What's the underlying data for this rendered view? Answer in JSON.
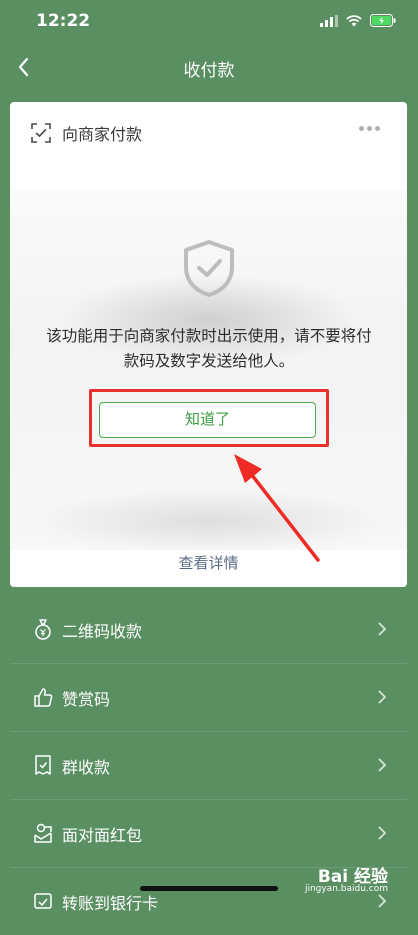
{
  "status_bar": {
    "time": "12:22"
  },
  "nav": {
    "title": "收付款"
  },
  "card": {
    "header_title": "向商家付款",
    "notice": "该功能用于向商家付款时出示使用，请不要将付款码及数字发送给他人。",
    "ok_button": "知道了",
    "detail_link": "查看详情"
  },
  "menu": {
    "items": [
      {
        "label": "二维码收款",
        "icon": "money-bag-icon"
      },
      {
        "label": "赞赏码",
        "icon": "thumbs-up-icon"
      },
      {
        "label": "群收款",
        "icon": "group-bill-icon"
      },
      {
        "label": "面对面红包",
        "icon": "red-packet-icon"
      },
      {
        "label": "转账到银行卡",
        "icon": "bank-card-icon"
      }
    ]
  },
  "watermark": {
    "main": "Bai 经验",
    "sub": "jingyan.baidu.com"
  },
  "colors": {
    "background": "#5a8f61",
    "accent_green": "#3a9b41",
    "highlight_red": "#e8312a",
    "link": "#5b6c85"
  }
}
